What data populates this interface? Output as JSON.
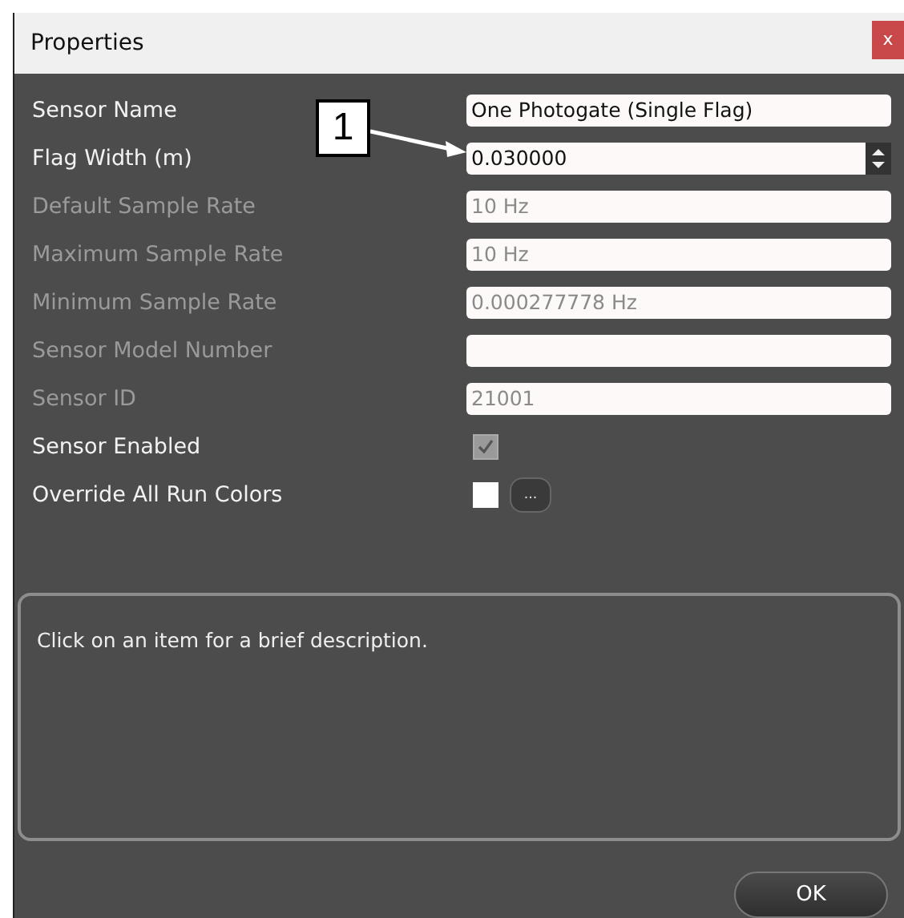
{
  "window": {
    "title": "Properties",
    "close": "x"
  },
  "callout": {
    "label": "1"
  },
  "properties": [
    {
      "kind": "text",
      "label": "Sensor Name",
      "value": "One Photogate (Single Flag)",
      "disabled": false
    },
    {
      "kind": "spin",
      "label": "Flag Width (m)",
      "value": "0.030000",
      "disabled": false
    },
    {
      "kind": "text",
      "label": "Default Sample Rate",
      "value": "10 Hz",
      "disabled": true
    },
    {
      "kind": "text",
      "label": "Maximum Sample Rate",
      "value": "10 Hz",
      "disabled": true
    },
    {
      "kind": "text",
      "label": "Minimum Sample Rate",
      "value": "0.000277778 Hz",
      "disabled": true
    },
    {
      "kind": "text",
      "label": "Sensor Model Number",
      "disabled": true
    },
    {
      "kind": "text",
      "label": "Sensor ID",
      "value": "21001",
      "disabled": true
    },
    {
      "kind": "check",
      "label": "Sensor Enabled",
      "checked": true,
      "disabled": false
    },
    {
      "kind": "color",
      "label": "Override All Run Colors",
      "color": "#ffffff",
      "button": "...",
      "disabled": false
    }
  ],
  "description": "Click on an item for a brief description.",
  "buttons": [
    "OK"
  ]
}
